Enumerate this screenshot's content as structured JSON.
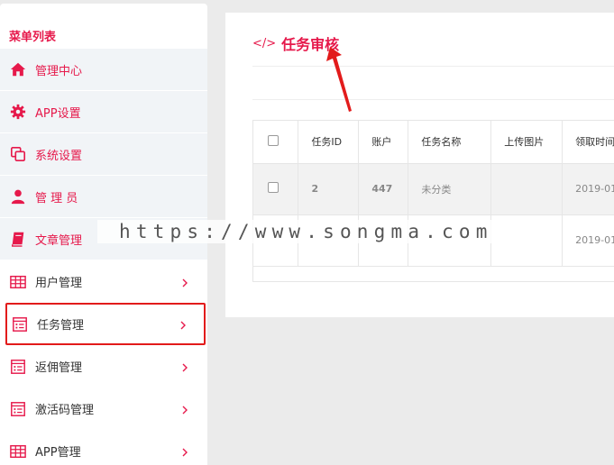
{
  "sidebar": {
    "title": "菜单列表",
    "items": [
      {
        "label": "管理中心",
        "icon": "home-icon"
      },
      {
        "label": "APP设置",
        "icon": "gear-icon"
      },
      {
        "label": "系统设置",
        "icon": "copy-icon"
      },
      {
        "label": "管 理 员",
        "icon": "user-icon"
      },
      {
        "label": "文章管理",
        "icon": "book-icon"
      },
      {
        "label": "用户管理",
        "icon": "table-icon"
      },
      {
        "label": "任务管理",
        "icon": "list-icon"
      },
      {
        "label": "返佣管理",
        "icon": "list-icon"
      },
      {
        "label": "激活码管理",
        "icon": "list-icon"
      },
      {
        "label": "APP管理",
        "icon": "table-icon"
      }
    ]
  },
  "panel": {
    "title": "任务审核",
    "title_icon": "</>"
  },
  "table": {
    "columns": [
      "任务ID",
      "账户",
      "任务名称",
      "上传图片",
      "领取时间"
    ],
    "rows": [
      {
        "id": "2",
        "account": "447",
        "name": "未分类",
        "image": "",
        "time": "2019-01"
      },
      {
        "id": "",
        "account": "",
        "name": "",
        "image": "",
        "time": "2019-01"
      }
    ]
  },
  "watermark": "https://www.songma.com",
  "colors": {
    "accent": "#e6194b",
    "highlight_border": "#e21b1b",
    "background": "#ebebeb"
  }
}
